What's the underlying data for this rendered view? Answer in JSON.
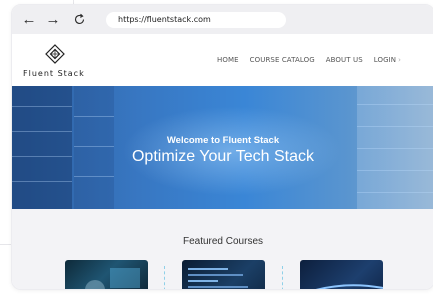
{
  "browser": {
    "back_icon": "arrow-left-icon",
    "forward_icon": "arrow-right-icon",
    "reload_icon": "reload-icon",
    "url": "https://fluentstack.com"
  },
  "site": {
    "logo_icon": "diamond-logo-icon",
    "logo_text": "Fluent Stack",
    "nav": [
      "HOME",
      "COURSE CATALOG",
      "ABOUT US",
      "LOGIN"
    ]
  },
  "hero": {
    "subtitle": "Welcome to Fluent Stack",
    "title": "Optimize Your Tech Stack"
  },
  "featured": {
    "title": "Featured Courses",
    "courses": [
      {
        "image": "person-at-computer"
      },
      {
        "image": "code-on-screen"
      },
      {
        "image": "city-night-highway"
      }
    ]
  },
  "colors": {
    "hero_blue": "#3a86d6",
    "section_bg": "#f3f3f6",
    "divider": "#8fd0e8"
  }
}
